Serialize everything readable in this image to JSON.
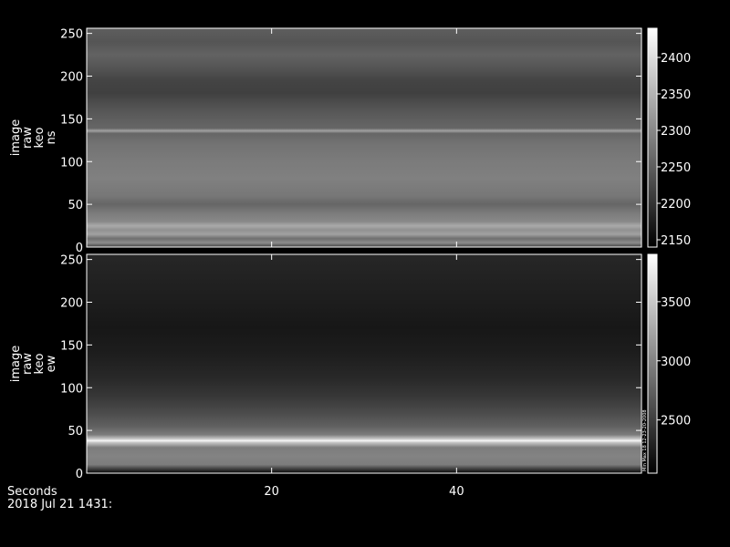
{
  "chart_data": [
    {
      "type": "heatmap",
      "ylabel_lines": [
        "image",
        "raw",
        "keo",
        "ns"
      ],
      "ylim": [
        0,
        256
      ],
      "yticks": [
        0,
        50,
        100,
        150,
        200,
        250
      ],
      "xlim": [
        0,
        60
      ],
      "colorbar": {
        "ticks": [
          2150,
          2200,
          2250,
          2300,
          2350,
          2400
        ],
        "range": [
          2140,
          2440
        ]
      },
      "profile": [
        {
          "y": 0,
          "v": 2215
        },
        {
          "y": 5,
          "v": 2305
        },
        {
          "y": 10,
          "v": 2270
        },
        {
          "y": 15,
          "v": 2330
        },
        {
          "y": 20,
          "v": 2310
        },
        {
          "y": 25,
          "v": 2340
        },
        {
          "y": 30,
          "v": 2300
        },
        {
          "y": 40,
          "v": 2285
        },
        {
          "y": 50,
          "v": 2260
        },
        {
          "y": 60,
          "v": 2280
        },
        {
          "y": 80,
          "v": 2290
        },
        {
          "y": 100,
          "v": 2285
        },
        {
          "y": 120,
          "v": 2275
        },
        {
          "y": 133,
          "v": 2260
        },
        {
          "y": 136,
          "v": 2330
        },
        {
          "y": 139,
          "v": 2260
        },
        {
          "y": 150,
          "v": 2250
        },
        {
          "y": 165,
          "v": 2235
        },
        {
          "y": 180,
          "v": 2215
        },
        {
          "y": 195,
          "v": 2220
        },
        {
          "y": 210,
          "v": 2240
        },
        {
          "y": 225,
          "v": 2255
        },
        {
          "y": 240,
          "v": 2240
        },
        {
          "y": 256,
          "v": 2250
        }
      ]
    },
    {
      "type": "heatmap",
      "ylabel_lines": [
        "image",
        "raw",
        "keo",
        "ew"
      ],
      "ylim": [
        0,
        256
      ],
      "yticks": [
        0,
        50,
        100,
        150,
        200,
        250
      ],
      "xlim": [
        0,
        60
      ],
      "xticks": [
        20,
        40
      ],
      "colorbar": {
        "ticks": [
          2500,
          3000,
          3500
        ],
        "range": [
          2050,
          3900
        ],
        "annotation": "Min Max 18 12-23-20-2008"
      },
      "profile": [
        {
          "y": 0,
          "v": 2080
        },
        {
          "y": 10,
          "v": 2950
        },
        {
          "y": 20,
          "v": 3000
        },
        {
          "y": 30,
          "v": 2950
        },
        {
          "y": 36,
          "v": 3500
        },
        {
          "y": 38,
          "v": 3850
        },
        {
          "y": 40,
          "v": 3500
        },
        {
          "y": 45,
          "v": 2950
        },
        {
          "y": 55,
          "v": 2750
        },
        {
          "y": 70,
          "v": 2600
        },
        {
          "y": 90,
          "v": 2450
        },
        {
          "y": 110,
          "v": 2350
        },
        {
          "y": 140,
          "v": 2260
        },
        {
          "y": 170,
          "v": 2220
        },
        {
          "y": 200,
          "v": 2260
        },
        {
          "y": 230,
          "v": 2300
        },
        {
          "y": 256,
          "v": 2330
        }
      ]
    }
  ],
  "footer": {
    "x_axis_title": "Seconds",
    "timestamp": "2018 Jul 21 1431:"
  }
}
